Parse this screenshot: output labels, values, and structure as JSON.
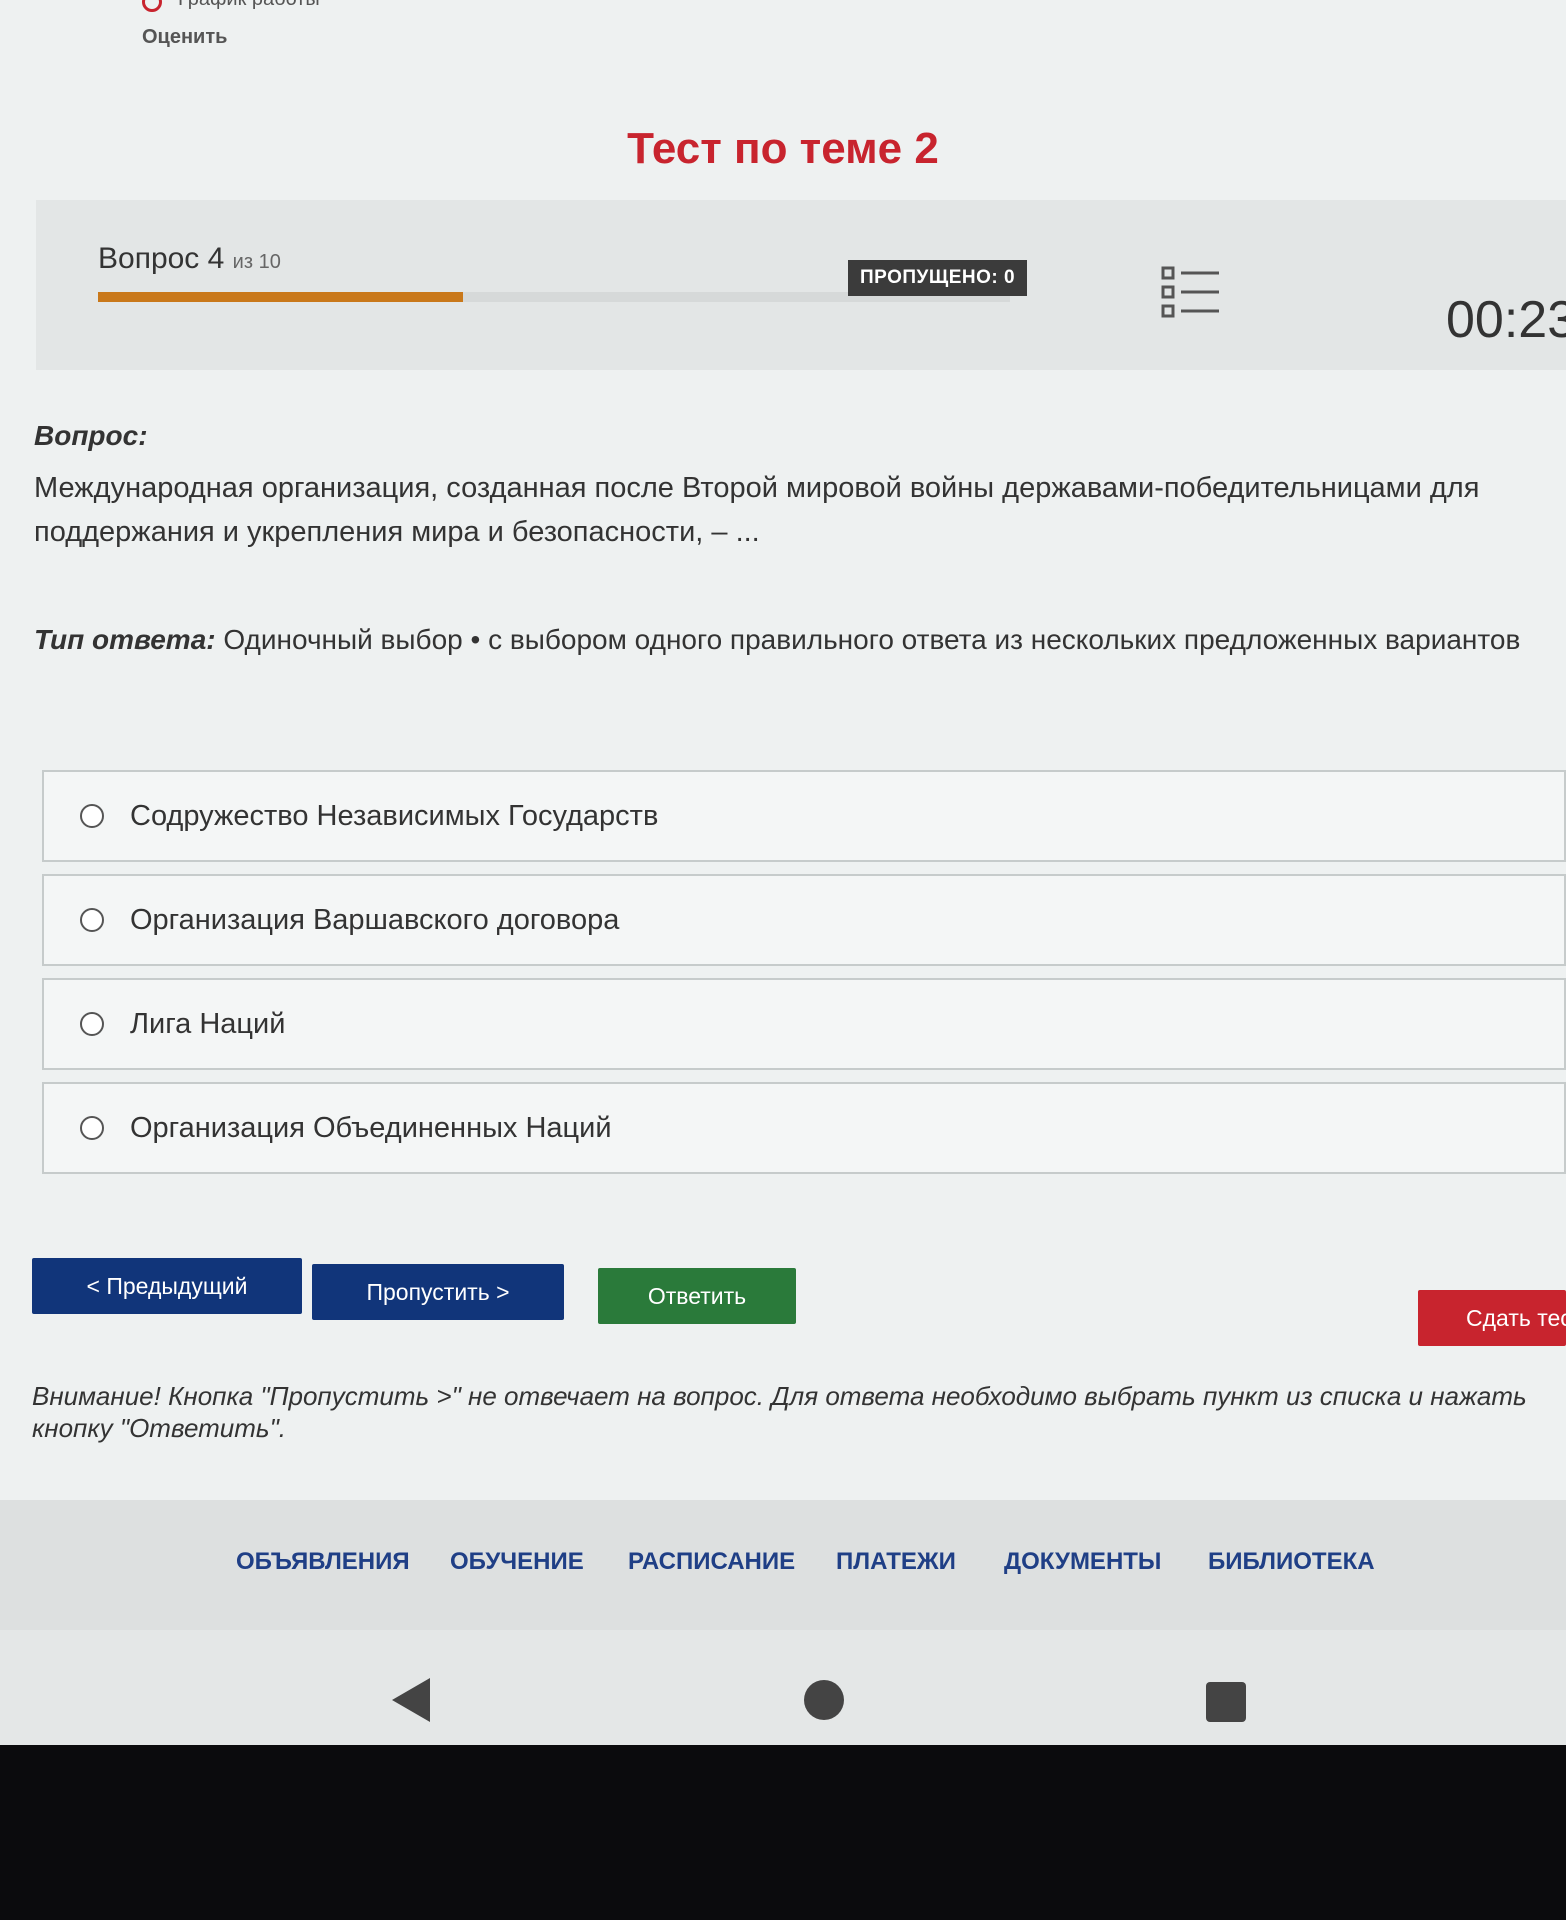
{
  "top_links": {
    "schedule_partial": "График работы",
    "rate": "Оценить"
  },
  "page_title": "Тест по теме 2",
  "header": {
    "question_label": "Вопрос 4",
    "question_of": "из 10",
    "progress_fraction": 0.4,
    "skipped_badge": "ПРОПУЩЕНО: 0",
    "timer": "00:23"
  },
  "question": {
    "label": "Вопрос:",
    "text": "Международная организация, созданная после Второй мировой войны державами-победительницами для поддержания и укрепления мира и безопасности, – ...",
    "answer_type_label": "Тип ответа:",
    "answer_type_value": "Одиночный выбор • с выбором одного правильного ответа из нескольких предложенных вариантов"
  },
  "options": [
    {
      "label": "Содружество Независимых Государств"
    },
    {
      "label": "Организация Варшавского договора"
    },
    {
      "label": "Лига Наций"
    },
    {
      "label": "Организация Объединенных Наций"
    }
  ],
  "buttons": {
    "prev": "< Предыдущий",
    "skip": "Пропустить >",
    "answer": "Ответить",
    "finish": "Сдать тест"
  },
  "warning": "Внимание! Кнопка \"Пропустить >\" не отвечает на вопрос. Для ответа необходимо выбрать пункт из списка и нажать кнопку \"Ответить\".",
  "footer_nav": [
    "ОБЪЯВЛЕНИЯ",
    "ОБУЧЕНИЕ",
    "РАСПИСАНИЕ",
    "ПЛАТЕЖИ",
    "ДОКУМЕНТЫ",
    "БИБЛИОТЕКА"
  ],
  "colors": {
    "accent_red": "#c8242e",
    "nav_blue": "#11357a",
    "answer_green": "#2a7a3a",
    "progress_orange": "#c9781a"
  }
}
